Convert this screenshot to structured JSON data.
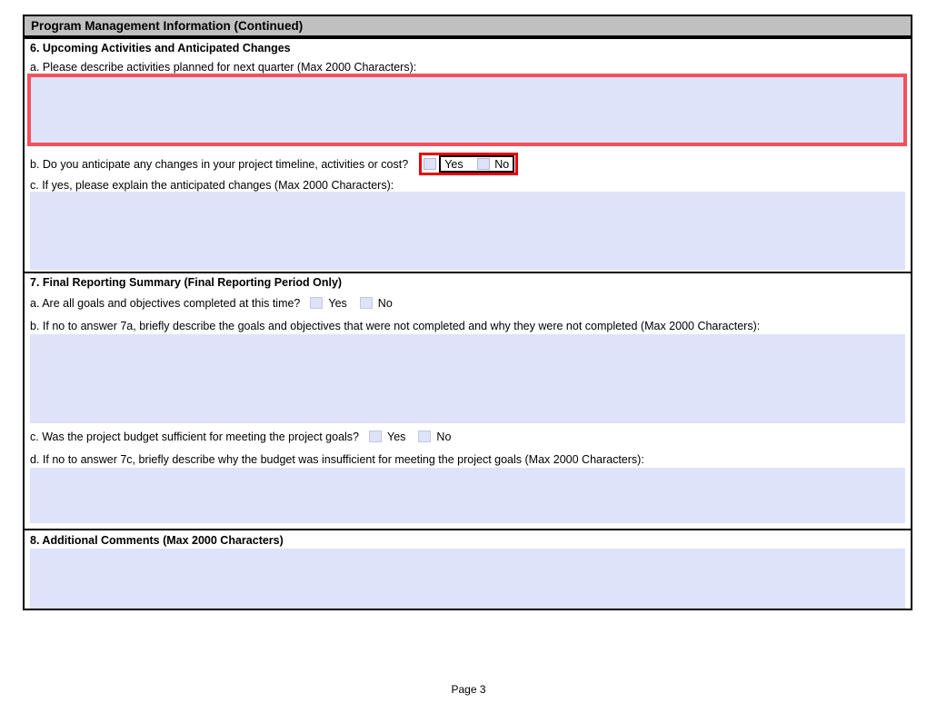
{
  "header": {
    "title": "Program Management Information (Continued)"
  },
  "section6": {
    "title": "6. Upcoming Activities and Anticipated Changes",
    "q_a": {
      "label": "a. Please describe activities planned for next quarter (Max 2000 Characters):",
      "value": ""
    },
    "q_b": {
      "label": "b. Do you anticipate any changes in your project timeline, activities or cost?",
      "yes_label": "Yes",
      "no_label": "No"
    },
    "q_c": {
      "label": "c. If yes, please explain the anticipated changes (Max 2000 Characters):",
      "value": ""
    }
  },
  "section7": {
    "title": "7. Final Reporting Summary (Final Reporting Period Only)",
    "q_a": {
      "label": "a. Are all goals and objectives completed at this time?",
      "yes_label": "Yes",
      "no_label": "No"
    },
    "q_b": {
      "label": "b. If no to answer 7a, briefly describe the goals and objectives that were not completed and why they were not completed (Max 2000 Characters):",
      "value": ""
    },
    "q_c": {
      "label": "c. Was the project budget sufficient for meeting the project goals?",
      "yes_label": "Yes",
      "no_label": "No"
    },
    "q_d": {
      "label": "d. If no to answer 7c, briefly describe why the budget was insufficient for meeting the project goals (Max 2000 Characters):",
      "value": ""
    }
  },
  "section8": {
    "title": "8. Additional Comments (Max 2000 Characters)",
    "value": ""
  },
  "footer": {
    "page_label": "Page 3"
  },
  "colors": {
    "header_bg": "#c0c0c0",
    "field_bg": "#dee3f9",
    "highlight_soft_red": "#f4515c",
    "highlight_red": "#e8000a",
    "border": "#000000"
  }
}
